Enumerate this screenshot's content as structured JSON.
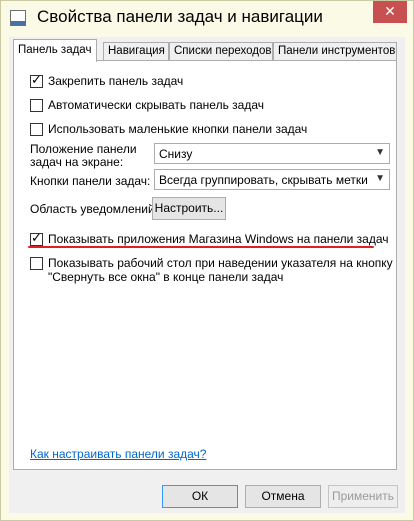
{
  "window": {
    "title": "Свойства панели задач и навигации",
    "close_glyph": "✕"
  },
  "tabs": [
    {
      "label": "Панель задач",
      "active": true
    },
    {
      "label": "Навигация",
      "active": false
    },
    {
      "label": "Списки переходов",
      "active": false
    },
    {
      "label": "Панели инструментов",
      "active": false
    }
  ],
  "options": {
    "lock": {
      "label": "Закрепить панель задач",
      "checked": true
    },
    "autohide": {
      "label": "Автоматически скрывать панель задач",
      "checked": false
    },
    "small_buttons": {
      "label": "Использовать маленькие кнопки панели задач",
      "checked": false
    },
    "position": {
      "label_line1": "Положение панели",
      "label_line2": "задач на экране:",
      "value": "Снизу"
    },
    "buttons": {
      "label": "Кнопки панели задач:",
      "value": "Всегда группировать, скрывать метки"
    },
    "notification": {
      "label": "Область уведомлений:",
      "button": "Настроить..."
    },
    "store_apps": {
      "label": "Показывать приложения Магазина Windows на панели задач",
      "checked": true
    },
    "peek": {
      "label_line1": "Показывать рабочий стол при наведении указателя на кнопку",
      "label_line2": "\"Свернуть все окна\" в конце панели задач",
      "checked": false
    }
  },
  "check_glyph": "✓",
  "arrow_glyph": "▼",
  "link": "Как настраивать панели задач?",
  "footer": {
    "ok": "ОК",
    "cancel": "Отмена",
    "apply": "Применить"
  }
}
